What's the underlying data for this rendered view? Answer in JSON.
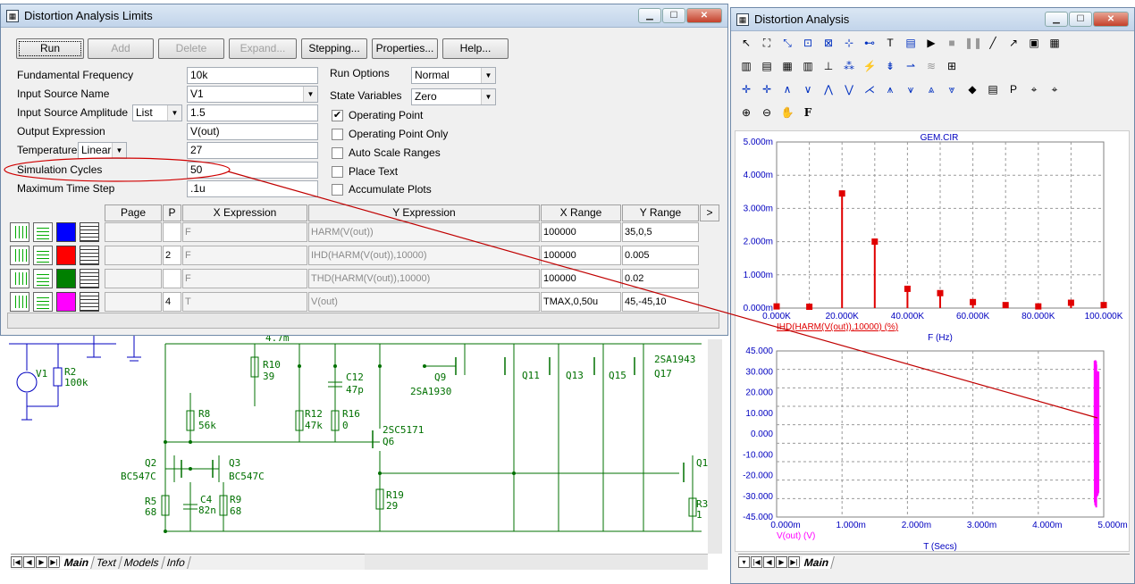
{
  "limits": {
    "title": "Distortion Analysis Limits",
    "buttons": {
      "run": "Run",
      "add": "Add",
      "delete": "Delete",
      "expand": "Expand...",
      "stepping": "Stepping...",
      "properties": "Properties...",
      "help": "Help..."
    },
    "fields": {
      "fund_freq_label": "Fundamental Frequency",
      "fund_freq": "10k",
      "input_source_label": "Input Source Name",
      "input_source": "V1",
      "input_amp_label": "Input Source Amplitude",
      "input_amp_mode": "List",
      "input_amp": "1.5",
      "output_expr_label": "Output Expression",
      "output_expr": "V(out)",
      "temp_label": "Temperature",
      "temp_mode": "Linear",
      "temp": "27",
      "sim_cycles_label": "Simulation Cycles",
      "sim_cycles": "50",
      "max_step_label": "Maximum Time Step",
      "max_step": ".1u"
    },
    "run_options_label": "Run Options",
    "run_options": "Normal",
    "state_vars_label": "State Variables",
    "state_vars": "Zero",
    "checks": [
      {
        "label": "Operating Point",
        "checked": "✔"
      },
      {
        "label": "Operating Point Only",
        "checked": ""
      },
      {
        "label": "Auto Scale Ranges",
        "checked": ""
      },
      {
        "label": "Place Text",
        "checked": ""
      },
      {
        "label": "Accumulate Plots",
        "checked": ""
      }
    ],
    "grid": {
      "headers": {
        "page": "Page",
        "p": "P",
        "x": "X Expression",
        "y": "Y Expression",
        "xr": "X Range",
        "yr": "Y Range",
        "more": ">"
      },
      "rows": [
        {
          "p": "",
          "x": "F",
          "y": "HARM(V(out))",
          "xr": "100000",
          "yr": "35,0,5",
          "color": "#0000ff"
        },
        {
          "p": "2",
          "x": "F",
          "y": "IHD(HARM(V(out)),10000)",
          "xr": "100000",
          "yr": "0.005",
          "color": "#ff0000"
        },
        {
          "p": "",
          "x": "F",
          "y": "THD(HARM(V(out)),10000)",
          "xr": "100000",
          "yr": "0.02",
          "color": "#008000"
        },
        {
          "p": "4",
          "x": "T",
          "y": "V(out)",
          "xr": "TMAX,0,50u",
          "yr": "45,-45,10",
          "color": "#ff00ff"
        }
      ]
    }
  },
  "analysis": {
    "title": "Distortion Analysis",
    "sheet_tab": "Main"
  },
  "schematic": {
    "tabs": [
      "Main",
      "Text",
      "Models",
      "Info"
    ],
    "labels": {
      "v1": "V1",
      "r2": "R2",
      "r2v": "100k",
      "r10": "R10",
      "r10v": "39",
      "c12": "C12",
      "c12v": "47p",
      "r12": "R12",
      "r12v": "47k",
      "r16": "R16",
      "r16v": "0",
      "q9": "Q9",
      "q9v": "2SA1930",
      "q11": "Q11",
      "q13": "Q13",
      "q15": "Q15",
      "q17": "Q17",
      "sa1943": "2SA1943",
      "r8": "R8",
      "r8v": "56k",
      "q6n": "2SC5171",
      "q6": "Q6",
      "q2": "Q2",
      "q2v": "BC547C",
      "q3": "Q3",
      "q3v": "BC547C",
      "r5": "R5",
      "r5v": "68",
      "c4": "C4",
      "c4v": "82n",
      "r9": "R9",
      "r9v": "68",
      "r19": "R19",
      "r19v": "29",
      "r3": "R3",
      "r3v": "1",
      "q1": "Q1",
      "top": "4.7m"
    }
  },
  "chart_data": [
    {
      "type": "bar",
      "title": "GEM.CIR",
      "xlabel": "F (Hz)",
      "series_label": "IHD(HARM(V(out)),10000) (%)",
      "x": [
        0,
        10000,
        20000,
        30000,
        40000,
        50000,
        60000,
        70000,
        80000,
        90000,
        100000
      ],
      "values": [
        5e-05,
        4e-05,
        0.00345,
        0.002,
        0.00058,
        0.00045,
        0.00018,
        9e-05,
        5e-05,
        0.00016,
        9e-05
      ],
      "xlim": [
        0,
        100000
      ],
      "ylim": [
        0,
        0.005
      ],
      "x_ticks": [
        "0.000K",
        "20.000K",
        "40.000K",
        "60.000K",
        "80.000K",
        "100.000K"
      ],
      "y_ticks": [
        "5.000m",
        "4.000m",
        "3.000m",
        "2.000m",
        "1.000m",
        "0.000m"
      ],
      "color": "#e00000",
      "grid": true
    },
    {
      "type": "line",
      "xlabel": "T (Secs)",
      "series_label": "V(out) (V)",
      "xlim": [
        0,
        0.005
      ],
      "ylim": [
        -45,
        45
      ],
      "x_ticks": [
        "0.000m",
        "1.000m",
        "2.000m",
        "3.000m",
        "4.000m",
        "5.000m"
      ],
      "y_ticks": [
        "45.000",
        "30.000",
        "20.000",
        "10.000",
        "0.000",
        "-10.000",
        "-20.000",
        "-30.000",
        "-45.000"
      ],
      "color": "#ff00ff",
      "grid": true
    }
  ]
}
